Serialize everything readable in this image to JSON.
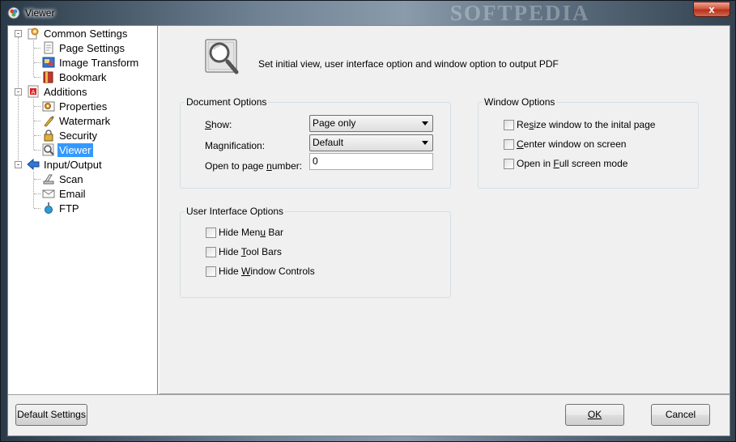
{
  "window": {
    "title": "Viewer",
    "watermark": "SOFTPEDIA",
    "close_glyph": "x"
  },
  "tree": {
    "items": [
      {
        "label": "Common Settings",
        "icon": "settings-icon",
        "level": 0,
        "expander": "-"
      },
      {
        "label": "Page Settings",
        "icon": "page-settings-icon",
        "level": 1
      },
      {
        "label": "Image Transform",
        "icon": "image-transform-icon",
        "level": 1
      },
      {
        "label": "Bookmark",
        "icon": "bookmark-icon",
        "level": 1
      },
      {
        "label": "Additions",
        "icon": "pdf-icon",
        "level": 0,
        "expander": "-"
      },
      {
        "label": "Properties",
        "icon": "properties-icon",
        "level": 1
      },
      {
        "label": "Watermark",
        "icon": "watermark-icon",
        "level": 1
      },
      {
        "label": "Security",
        "icon": "security-icon",
        "level": 1
      },
      {
        "label": "Viewer",
        "icon": "viewer-icon",
        "level": 1,
        "selected": true
      },
      {
        "label": "Input/Output",
        "icon": "input-output-icon",
        "level": 0,
        "expander": "-"
      },
      {
        "label": "Scan",
        "icon": "scan-icon",
        "level": 1
      },
      {
        "label": "Email",
        "icon": "email-icon",
        "level": 1
      },
      {
        "label": "FTP",
        "icon": "ftp-icon",
        "level": 1
      }
    ]
  },
  "header": {
    "icon": "magnifier-icon",
    "description": "Set initial view, user interface option and window option to output PDF"
  },
  "document_options": {
    "title": "Document Options",
    "show_label": "Show:",
    "show_value": "Page only",
    "magnification_label": "Magnification:",
    "magnification_value": "Default",
    "open_page_label": "Open to page number:",
    "open_page_value": "0"
  },
  "window_options": {
    "title": "Window Options",
    "options": [
      {
        "label": "Resize window to the inital page",
        "checked": false
      },
      {
        "label": "Center window on screen",
        "checked": false
      },
      {
        "label": "Open in Full screen mode",
        "checked": false
      }
    ]
  },
  "ui_options": {
    "title": "User Interface Options",
    "options": [
      {
        "label": "Hide Menu Bar",
        "checked": false
      },
      {
        "label": "Hide Tool Bars",
        "checked": false
      },
      {
        "label": "Hide Window Controls",
        "checked": false
      }
    ]
  },
  "buttons": {
    "default_settings": "Default Settings",
    "ok": "OK",
    "cancel": "Cancel"
  }
}
